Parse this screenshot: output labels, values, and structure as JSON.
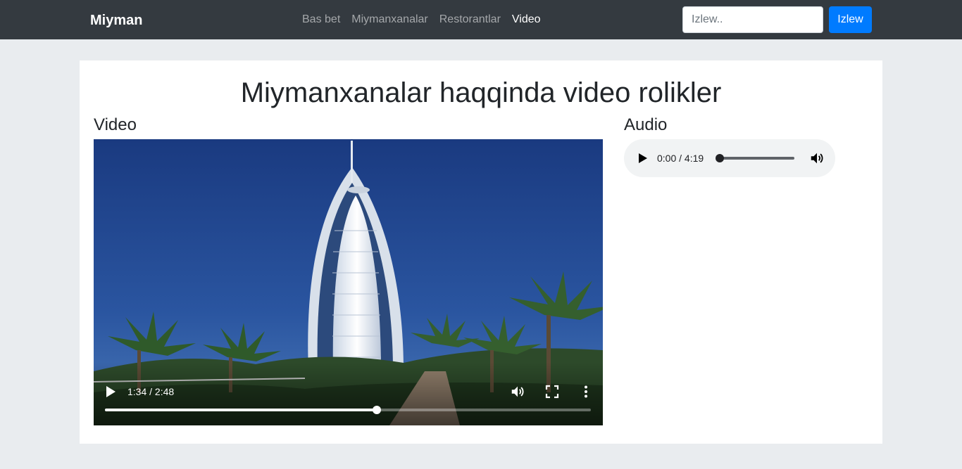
{
  "navbar": {
    "brand": "Miyman",
    "links": [
      {
        "label": "Bas bet",
        "active": false
      },
      {
        "label": "Miymanxanalar",
        "active": false
      },
      {
        "label": "Restorantlar",
        "active": false
      },
      {
        "label": "Video",
        "active": true
      }
    ],
    "search": {
      "placeholder": "Izlew..",
      "value": ""
    },
    "search_button": "Izlew"
  },
  "main": {
    "title": "Miymanxanalar haqqinda video rolikler",
    "video_heading": "Video",
    "audio_heading": "Audio"
  },
  "video_player": {
    "time": "1:34 / 2:48",
    "progress": 0.56,
    "icons": [
      "play-icon",
      "volume-icon",
      "fullscreen-icon",
      "more-options-icon"
    ]
  },
  "audio_player": {
    "time": "0:00 / 4:19",
    "progress": 0,
    "icons": [
      "play-icon",
      "volume-icon"
    ]
  },
  "colors": {
    "navbar_bg": "#343a40",
    "page_bg": "#e9ecef",
    "button_primary": "#007bff",
    "audio_bg": "#f1f3f4"
  }
}
